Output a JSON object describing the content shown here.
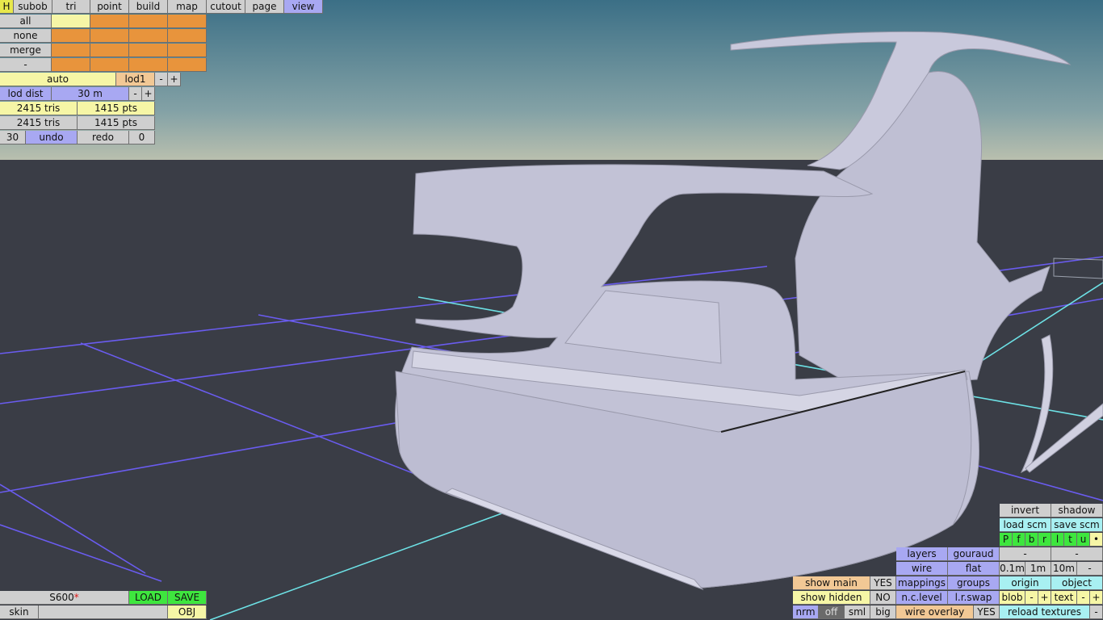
{
  "top_tabs": {
    "h": "H",
    "subob": "subob",
    "tri": "tri",
    "point": "point",
    "build": "build",
    "map": "map",
    "cutout": "cutout",
    "page": "page",
    "view": "view"
  },
  "select": {
    "all": "all",
    "none": "none",
    "merge": "merge",
    "minus": "-"
  },
  "lod": {
    "auto": "auto",
    "level": "lod1",
    "minus": "-",
    "plus": "+",
    "dist_label": "lod dist",
    "dist_value": "30 m",
    "dist_minus": "-",
    "dist_plus": "+"
  },
  "stats": {
    "tris1": "2415 tris",
    "pts1": "1415 pts",
    "tris2": "2415 tris",
    "pts2": "1415 pts"
  },
  "history": {
    "count": "30",
    "undo": "undo",
    "redo": "redo",
    "redo_count": "0"
  },
  "file": {
    "name": "S600",
    "modified_mark": "*",
    "load": "LOAD",
    "save": "SAVE",
    "skin": "skin",
    "skin_value": "",
    "format": "OBJ"
  },
  "view_panel": {
    "invert": "invert",
    "shadow": "shadow",
    "load_scm": "load scm",
    "save_scm": "save scm",
    "view_letters": [
      "P",
      "f",
      "b",
      "r",
      "l",
      "t",
      "u",
      "•"
    ],
    "layers": "layers",
    "gouraud": "gouraud",
    "dash1": "-",
    "dash2": "-",
    "wire": "wire",
    "flat": "flat",
    "scale_01": "0.1m",
    "scale_1": "1m",
    "scale_10": "10m",
    "scale_minus": "-",
    "show_main": "show main",
    "show_main_val": "YES",
    "mappings": "mappings",
    "groups": "groups",
    "origin": "origin",
    "object": "object",
    "show_hidden": "show hidden",
    "show_hidden_val": "NO",
    "nc_level": "n.c.level",
    "lr_swap": "l.r.swap",
    "blob": "blob",
    "blob_minus": "-",
    "blob_plus": "+",
    "text": "text",
    "text_minus": "-",
    "text_plus": "+",
    "nrm": "nrm",
    "off": "off",
    "sml": "sml",
    "big": "big",
    "wire_overlay": "wire overlay",
    "wire_overlay_val": "YES",
    "reload_textures": "reload textures",
    "reload_minus": "-"
  }
}
